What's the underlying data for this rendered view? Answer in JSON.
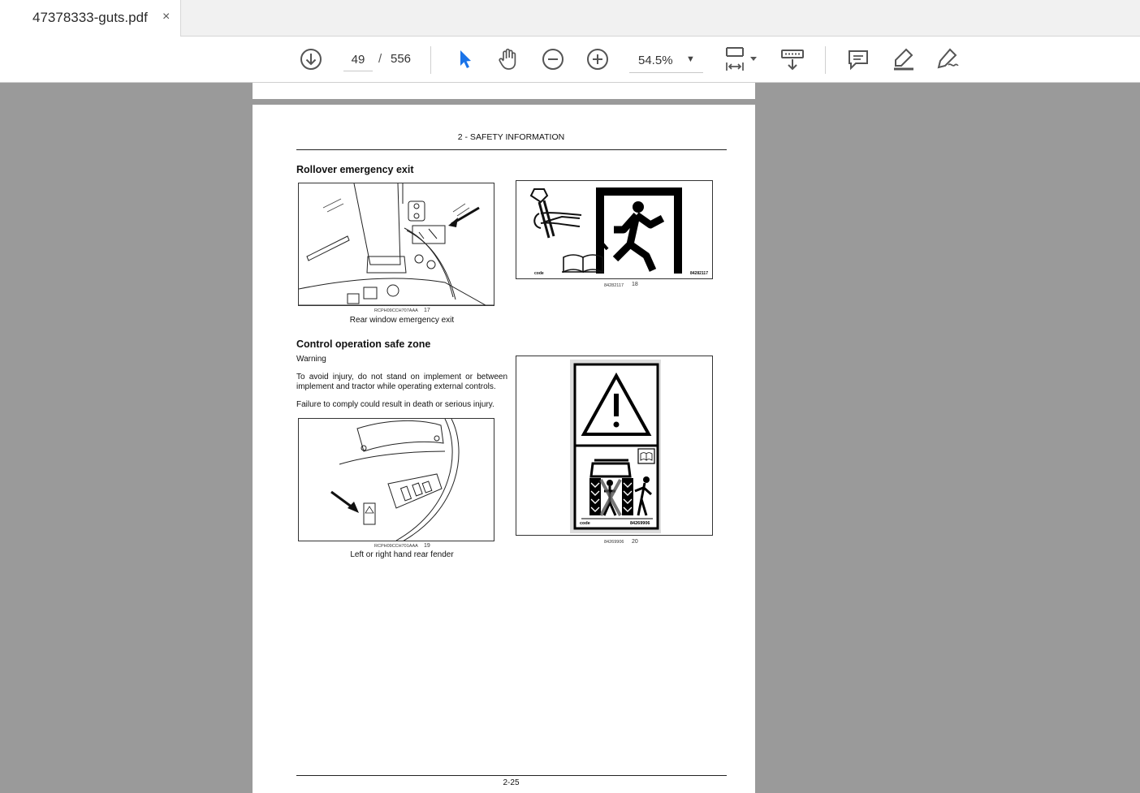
{
  "tab": {
    "title": "47378333-guts.pdf",
    "close": "×"
  },
  "toolbar": {
    "page_current": "49",
    "page_sep": "/",
    "page_total": "556",
    "zoom": "54.5%",
    "icons": [
      "download-icon",
      "select-cursor-icon",
      "hand-icon",
      "zoom-out-icon",
      "zoom-in-icon",
      "fit-page-icon",
      "scroll-mode-icon",
      "comment-icon",
      "highlight-icon",
      "draw-icon"
    ]
  },
  "document": {
    "header": "2 - SAFETY INFORMATION",
    "section1": {
      "title": "Rollover emergency exit",
      "fig17": {
        "code": "RCPH09CCH707AAA",
        "num": "17",
        "caption": "Rear window emergency exit"
      },
      "fig18": {
        "code": "84282117",
        "num": "18",
        "label_code": "code",
        "label_num": "84282117"
      }
    },
    "section2": {
      "title": "Control operation safe zone",
      "warning": "Warning",
      "para1": "To avoid injury, do not stand on implement or between implement and tractor while operating external controls.",
      "para2": "Failure to comply could result in death or serious injury.",
      "fig19": {
        "code": "RCPH09CCH701AAA",
        "num": "19",
        "caption": "Left or right hand rear fender"
      },
      "fig20": {
        "code": "84269906",
        "num": "20",
        "label_code": "code",
        "label_num": "84269906"
      }
    },
    "footer": "2-25"
  },
  "colors": {
    "accent": "#1a73e8",
    "viewer_bg": "#9a9a9a"
  }
}
